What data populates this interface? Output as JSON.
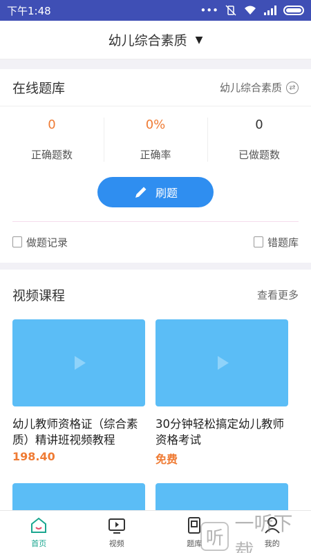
{
  "status_bar": {
    "time": "下午1:48",
    "icons": [
      "dots-icon",
      "vibrate-off-icon",
      "wifi-icon",
      "signal-icon",
      "battery-icon"
    ]
  },
  "header": {
    "title": "幼儿综合素质",
    "caret": "▼"
  },
  "online_bank": {
    "title": "在线题库",
    "subject": "幼儿综合素质",
    "stats": [
      {
        "value": "0",
        "label": "正确题数",
        "color": "#ef7b34"
      },
      {
        "value": "0%",
        "label": "正确率",
        "color": "#ef7b34"
      },
      {
        "value": "0",
        "label": "已做题数",
        "color": "#333333"
      }
    ],
    "practice_button": "刷题",
    "record_link": "做题记录",
    "wrong_link": "错题库"
  },
  "video_courses": {
    "title": "视频课程",
    "more": "查看更多",
    "courses": [
      {
        "name": "幼儿教师资格证（综合素质）精讲班视频教程",
        "price": "198.40"
      },
      {
        "name": "30分钟轻松搞定幼儿教师资格考试",
        "price": "免费"
      }
    ]
  },
  "tabs": [
    {
      "label": "首页",
      "icon": "home-icon",
      "active": true
    },
    {
      "label": "视频",
      "icon": "video-icon",
      "active": false
    },
    {
      "label": "题库",
      "icon": "question-bank-icon",
      "active": false
    },
    {
      "label": "我的",
      "icon": "profile-icon",
      "active": false
    }
  ],
  "watermark": {
    "mark": "听",
    "text": "一听下载"
  },
  "colors": {
    "status_bar": "#3f4fb5",
    "accent_blue": "#2f8ef0",
    "thumb_blue": "#5bbdf6",
    "orange": "#ef7b34",
    "tab_active": "#1aa68f"
  }
}
